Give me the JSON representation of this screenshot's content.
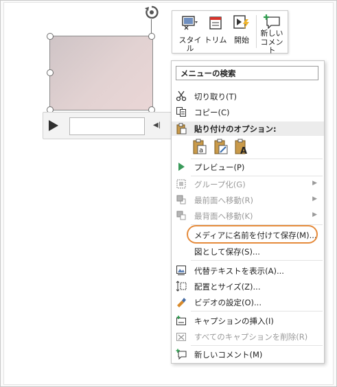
{
  "mini_toolbar": {
    "buttons": [
      {
        "label": "スタイル",
        "icon": "style-icon"
      },
      {
        "label": "トリム",
        "icon": "trim-icon"
      },
      {
        "label": "開始",
        "icon": "start-icon"
      },
      {
        "label_line1": "新しい",
        "label_line2": "コメント",
        "icon": "new-comment-icon"
      }
    ]
  },
  "context_menu": {
    "search_label": "メニューの検索",
    "paste_options_label": "貼り付けのオプション:",
    "items": {
      "cut": "切り取り(T)",
      "copy": "コピー(C)",
      "preview": "プレビュー(P)",
      "group": "グループ化(G)",
      "bring_to_front": "最前面へ移動(R)",
      "send_to_back": "最背面へ移動(K)",
      "save_media_as": "メディアに名前を付けて保存(M)...",
      "save_as_picture": "図として保存(S)...",
      "edit_alt_text": "代替テキストを表示(A)...",
      "size_and_position": "配置とサイズ(Z)...",
      "format_video": "ビデオの設定(O)...",
      "insert_captions": "キャプションの挿入(I)",
      "remove_all_captions": "すべてのキャプションを削除(R)",
      "new_comment": "新しいコメント(M)"
    }
  },
  "colors": {
    "highlight_ring": "#e58a3a",
    "preview_arrow": "#3a9a5a",
    "disabled_text": "#9a9a9a"
  }
}
